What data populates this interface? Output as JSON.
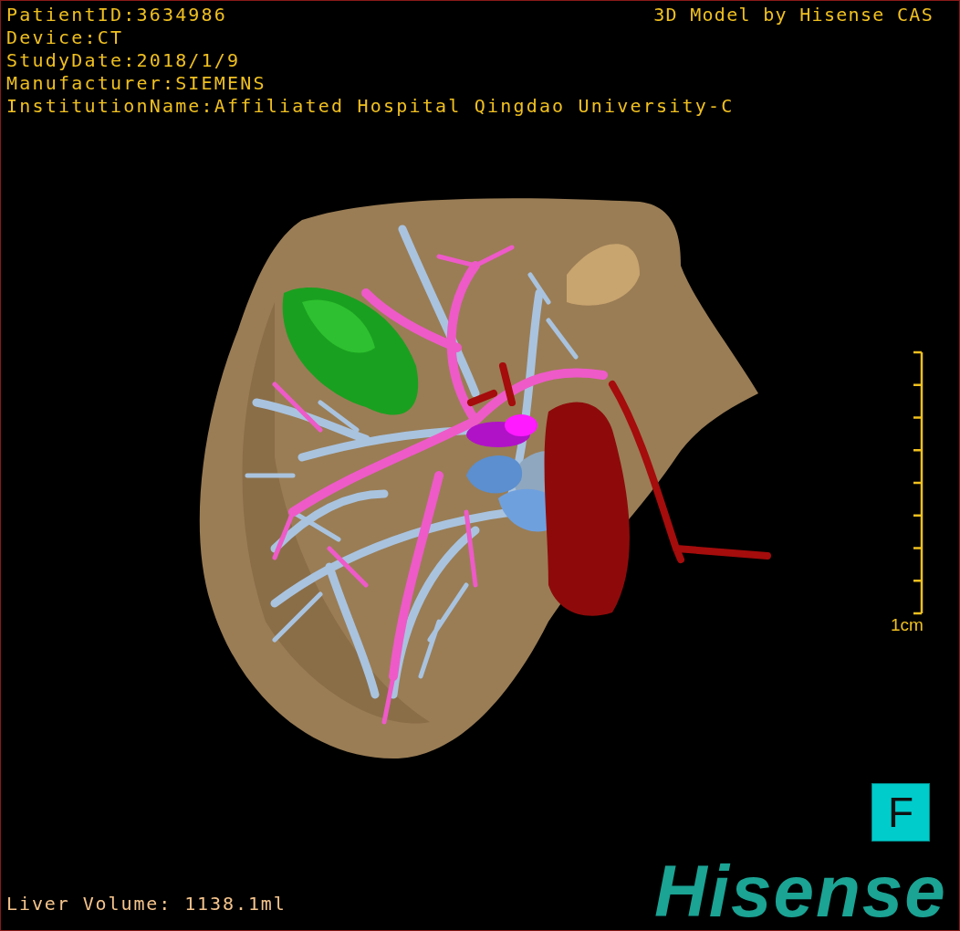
{
  "info_lines": [
    "PatientID:3634986",
    "Device:CT",
    "StudyDate:2018/1/9",
    "Manufacturer:SIEMENS",
    "InstitutionName:Affiliated Hospital Qingdao University-C"
  ],
  "model_credit": "3D Model by Hisense CAS",
  "scale_bar": {
    "label": "1cm"
  },
  "orientation_button": {
    "label": "F"
  },
  "footer": {
    "liver_volume": "Liver Volume: 1138.1ml"
  },
  "logo": {
    "text": "Hisense"
  }
}
